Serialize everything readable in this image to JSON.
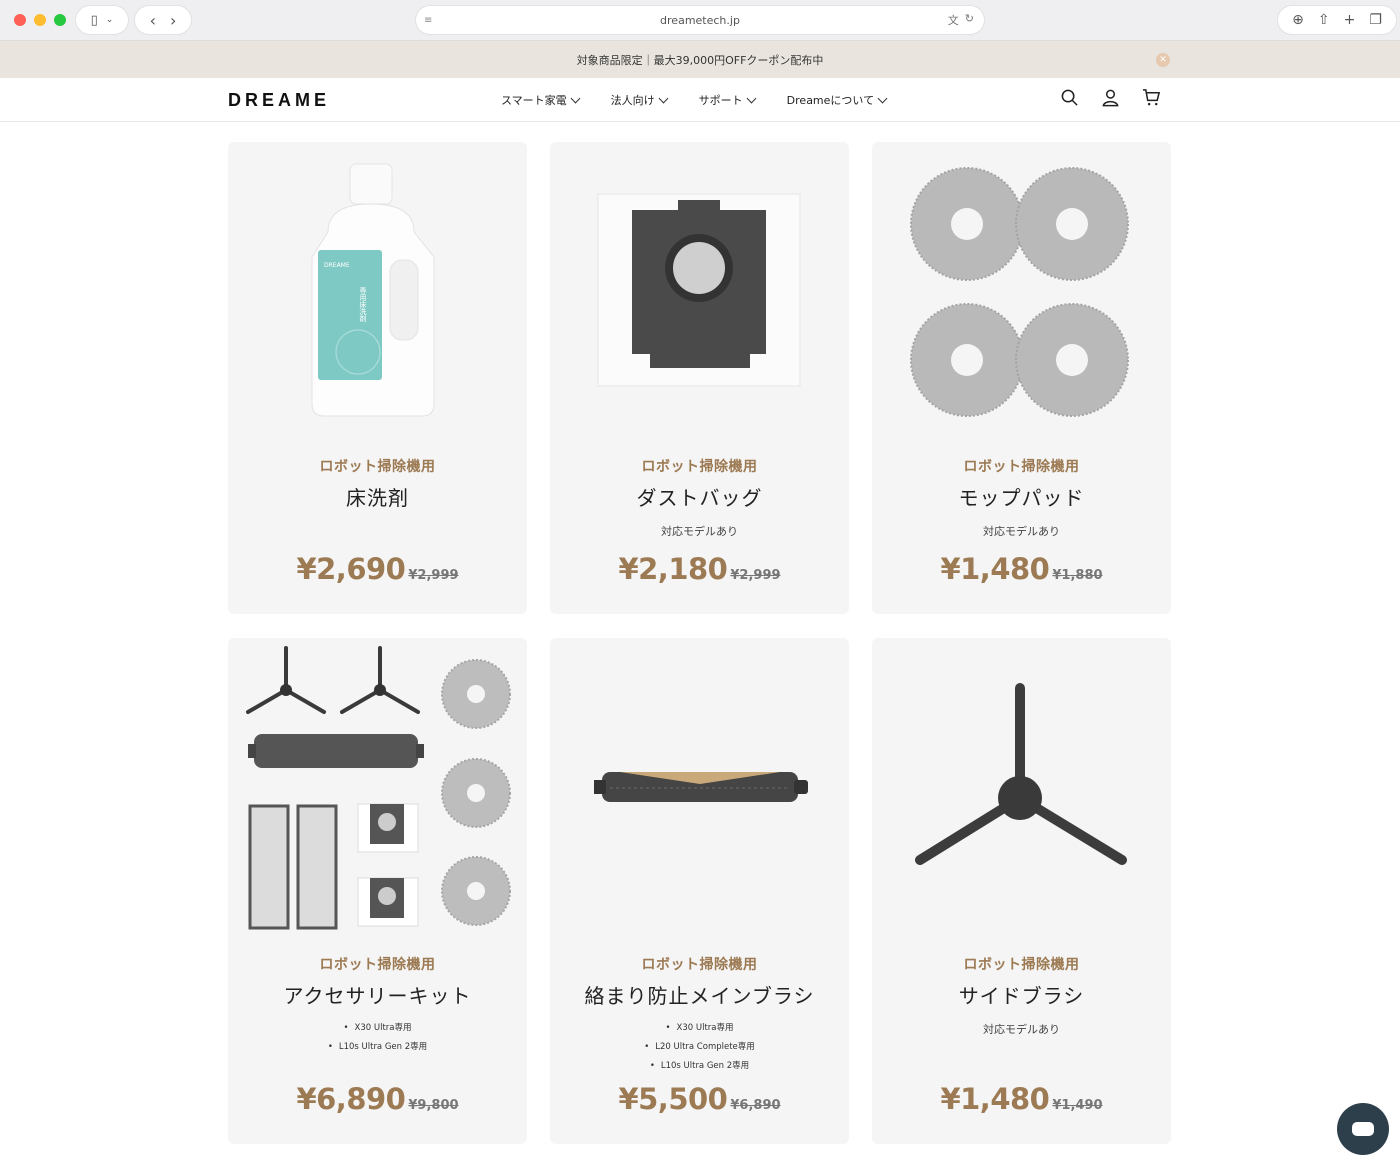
{
  "browser": {
    "url": "dreametech.jp"
  },
  "announcement": "対象商品限定｜最大39,000円OFFクーポン配布中",
  "header": {
    "logo": "DREAME",
    "menu": [
      "スマート家電",
      "法人向け",
      "サポート",
      "Dreameについて"
    ]
  },
  "products": [
    {
      "category": "ロボット掃除機用",
      "name": "床洗剤",
      "sub": "",
      "bullets": [],
      "price": "¥2,690",
      "was": "¥2,999",
      "label_text": "DREAME",
      "label_jp": "専用床洗剤"
    },
    {
      "category": "ロボット掃除機用",
      "name": "ダストバッグ",
      "sub": "対応モデルあり",
      "bullets": [],
      "price": "¥2,180",
      "was": "¥2,999"
    },
    {
      "category": "ロボット掃除機用",
      "name": "モップパッド",
      "sub": "対応モデルあり",
      "bullets": [],
      "price": "¥1,480",
      "was": "¥1,880"
    },
    {
      "category": "ロボット掃除機用",
      "name": "アクセサリーキット",
      "sub": "",
      "bullets": [
        "X30 Ultra専用",
        "L10s Ultra Gen 2専用"
      ],
      "price": "¥6,890",
      "was": "¥9,800"
    },
    {
      "category": "ロボット掃除機用",
      "name": "絡まり防止メインブラシ",
      "sub": "",
      "bullets": [
        "X30 Ultra専用",
        "L20 Ultra Complete専用",
        "L10s Ultra Gen 2専用"
      ],
      "price": "¥5,500",
      "was": "¥6,890"
    },
    {
      "category": "ロボット掃除機用",
      "name": "サイドブラシ",
      "sub": "対応モデルあり",
      "bullets": [],
      "price": "¥1,480",
      "was": "¥1,490"
    }
  ],
  "colors": {
    "accent": "#9c7a53",
    "card_bg": "#f5f5f5",
    "chat": "#2d3f4a"
  },
  "icons": [
    "search-icon",
    "account-icon",
    "cart-icon",
    "chat-icon"
  ]
}
